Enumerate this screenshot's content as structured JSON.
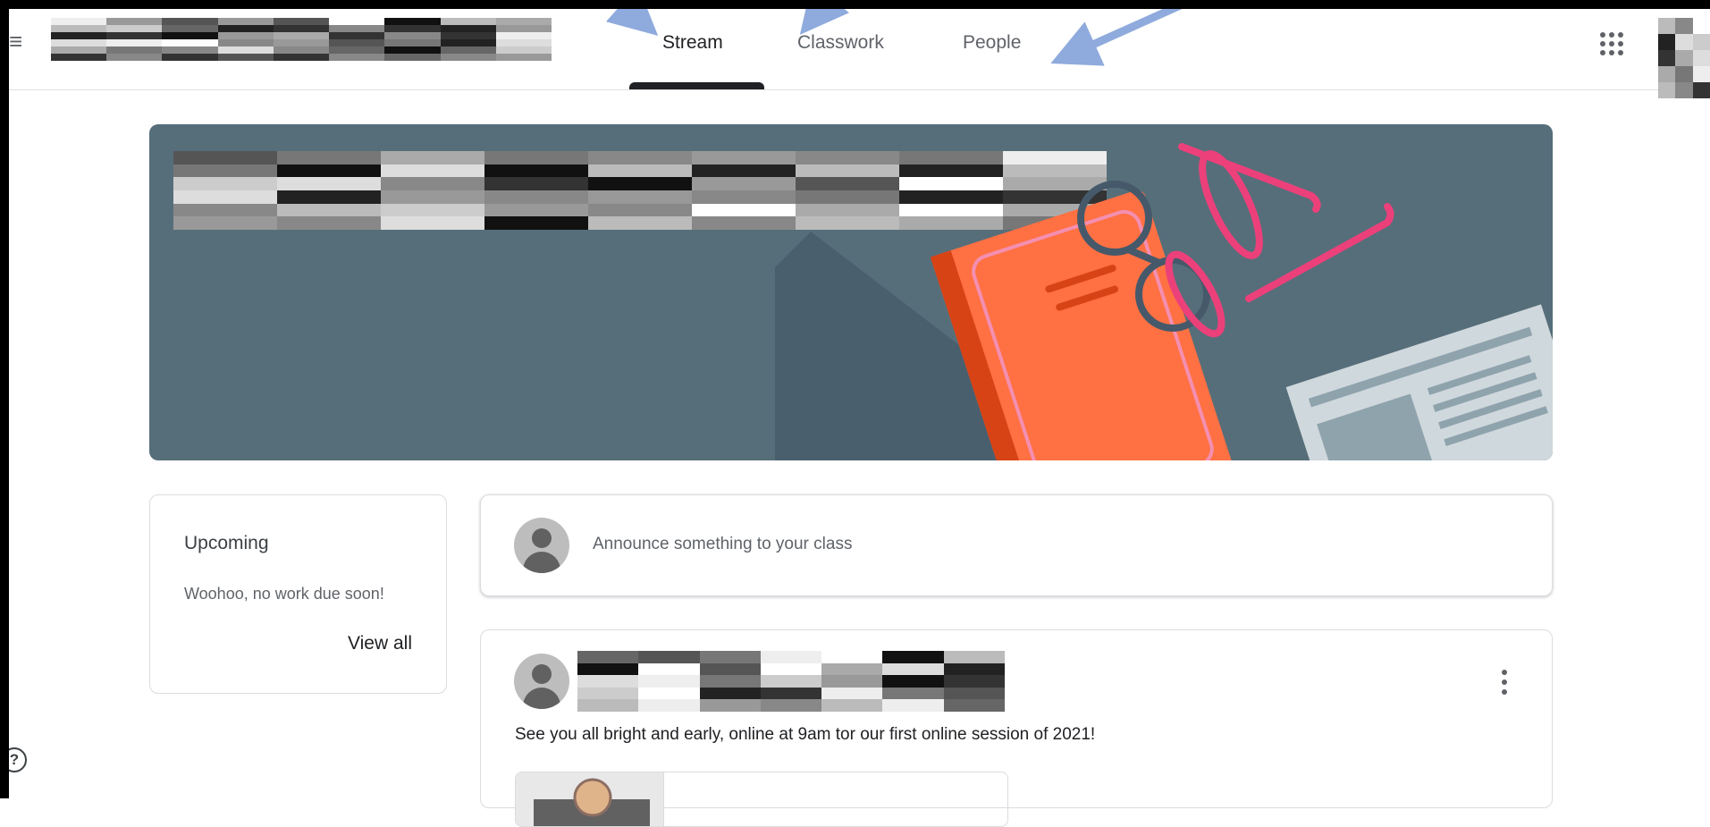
{
  "tabs": [
    {
      "label": "Stream",
      "active": true
    },
    {
      "label": "Classwork",
      "active": false
    },
    {
      "label": "People",
      "active": false
    }
  ],
  "upcoming": {
    "title": "Upcoming",
    "message": "Woohoo, no work due soon!",
    "view_all": "View all"
  },
  "announce": {
    "placeholder": "Announce something to your class"
  },
  "post": {
    "text": "See you all bright and early, online at 9am tor our first online session of 2021!"
  },
  "icons": {
    "menu": "hamburger-menu-icon",
    "apps": "google-apps-icon",
    "more": "more-vert-icon",
    "help": "help-icon"
  },
  "colors": {
    "banner": "#566e7a",
    "arrow": "#8faadc",
    "book": "#ff7043",
    "glasses": "#ec407a"
  }
}
